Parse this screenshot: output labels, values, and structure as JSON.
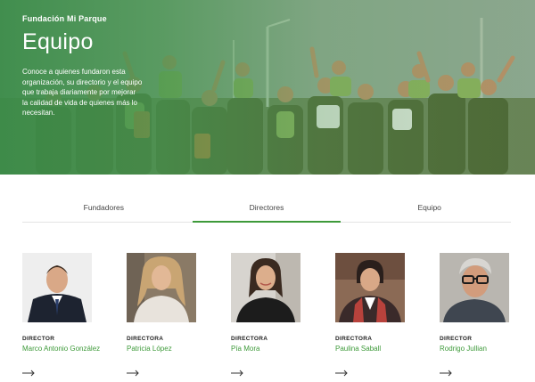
{
  "hero": {
    "brand": "Fundación Mi Parque",
    "title": "Equipo",
    "description": "Conoce a quienes fundaron esta organización, su directorio y el equipo que trabaja diariamente por mejorar la calidad de vida de quienes más lo necesitan."
  },
  "tabs": [
    {
      "label": "Fundadores",
      "active": false
    },
    {
      "label": "Directores",
      "active": true
    },
    {
      "label": "Equipo",
      "active": false
    }
  ],
  "members": [
    {
      "role": "DIRECTOR",
      "name": "Marco Antonio González"
    },
    {
      "role": "DIRECTORA",
      "name": "Patricia López"
    },
    {
      "role": "DIRECTORA",
      "name": "Pía Mora"
    },
    {
      "role": "DIRECTORA",
      "name": "Paulina Saball"
    },
    {
      "role": "DIRECTOR",
      "name": "Rodrigo Jullian"
    }
  ],
  "colors": {
    "accent": "#3e9a3a",
    "hero_overlay": "#3a8c48"
  },
  "icons": {
    "card_link": "arrow-right-icon"
  }
}
